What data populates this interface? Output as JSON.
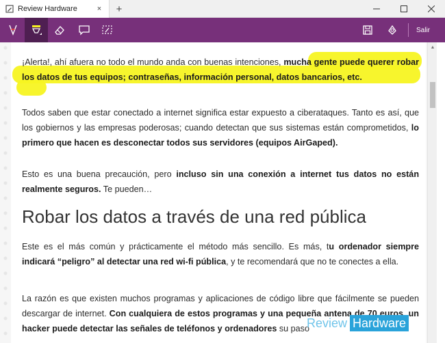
{
  "window": {
    "tab_title": "Review Hardware",
    "close_tab": "×",
    "new_tab": "+",
    "minimize": "—",
    "maximize": "☐",
    "close": "✕"
  },
  "toolbar": {
    "tools": [
      "pen-icon",
      "highlighter-icon",
      "eraser-icon",
      "comment-icon",
      "clip-icon"
    ],
    "active_tool": "highlighter-icon",
    "right_tools": [
      "save-icon",
      "share-icon"
    ],
    "exit_label": "Salir",
    "accent": "#77307a",
    "highlight_color": "#f7f422"
  },
  "article": {
    "p1_normal": "¡Alerta!, ahí afuera no todo el mundo anda con buenas intenciones, ",
    "p1_bold": "mucha gente puede querer robar los datos de tus equipos; contraseñas, información personal, datos bancarios, etc.",
    "p2_normal": "Todos saben que estar conectado a internet significa estar expuesto a ciberataques. Tanto es así, que los gobiernos y las empresas poderosas; cuando detectan que sus sistemas están comprometidos, ",
    "p2_bold": "lo primero que hacen es desconectar todos sus servidores (equipos AirGaped).",
    "p3_normal_a": "Esto es una buena precaución, pero ",
    "p3_bold": "incluso sin  una conexión a internet tus datos no están realmente seguros.",
    "p3_normal_b": " Te pueden…",
    "heading": "Robar los datos a través de una red pública",
    "p4_normal_a": "Este es el más común y prácticamente el método más sencillo. Es más, t",
    "p4_bold": "u ordenador siempre indicará  “peligro” al detectar una red wi-fi pública",
    "p4_normal_b": ", y te recomendará que no te conectes a ella.",
    "p5_normal": "La razón es que existen muchos programas y aplicaciones de código libre que fácilmente se pueden descargar de internet. ",
    "p5_bold": "Con cualquiera de estos programas y una pequeña antena de 70 euros, un hacker puede detectar las señales de teléfonos y ordenadores",
    "p5_cut": "su paso"
  },
  "watermark": {
    "part1": "Review",
    "part2": "Hardware"
  }
}
